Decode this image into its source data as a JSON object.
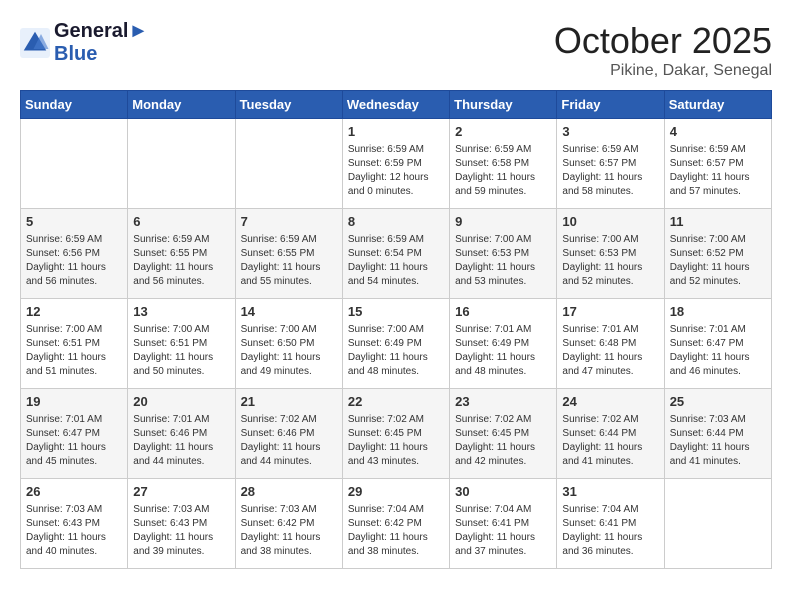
{
  "header": {
    "logo_line1": "General",
    "logo_line2": "Blue",
    "month": "October 2025",
    "location": "Pikine, Dakar, Senegal"
  },
  "days_of_week": [
    "Sunday",
    "Monday",
    "Tuesday",
    "Wednesday",
    "Thursday",
    "Friday",
    "Saturday"
  ],
  "weeks": [
    [
      {
        "day": "",
        "info": ""
      },
      {
        "day": "",
        "info": ""
      },
      {
        "day": "",
        "info": ""
      },
      {
        "day": "1",
        "info": "Sunrise: 6:59 AM\nSunset: 6:59 PM\nDaylight: 12 hours\nand 0 minutes."
      },
      {
        "day": "2",
        "info": "Sunrise: 6:59 AM\nSunset: 6:58 PM\nDaylight: 11 hours\nand 59 minutes."
      },
      {
        "day": "3",
        "info": "Sunrise: 6:59 AM\nSunset: 6:57 PM\nDaylight: 11 hours\nand 58 minutes."
      },
      {
        "day": "4",
        "info": "Sunrise: 6:59 AM\nSunset: 6:57 PM\nDaylight: 11 hours\nand 57 minutes."
      }
    ],
    [
      {
        "day": "5",
        "info": "Sunrise: 6:59 AM\nSunset: 6:56 PM\nDaylight: 11 hours\nand 56 minutes."
      },
      {
        "day": "6",
        "info": "Sunrise: 6:59 AM\nSunset: 6:55 PM\nDaylight: 11 hours\nand 56 minutes."
      },
      {
        "day": "7",
        "info": "Sunrise: 6:59 AM\nSunset: 6:55 PM\nDaylight: 11 hours\nand 55 minutes."
      },
      {
        "day": "8",
        "info": "Sunrise: 6:59 AM\nSunset: 6:54 PM\nDaylight: 11 hours\nand 54 minutes."
      },
      {
        "day": "9",
        "info": "Sunrise: 7:00 AM\nSunset: 6:53 PM\nDaylight: 11 hours\nand 53 minutes."
      },
      {
        "day": "10",
        "info": "Sunrise: 7:00 AM\nSunset: 6:53 PM\nDaylight: 11 hours\nand 52 minutes."
      },
      {
        "day": "11",
        "info": "Sunrise: 7:00 AM\nSunset: 6:52 PM\nDaylight: 11 hours\nand 52 minutes."
      }
    ],
    [
      {
        "day": "12",
        "info": "Sunrise: 7:00 AM\nSunset: 6:51 PM\nDaylight: 11 hours\nand 51 minutes."
      },
      {
        "day": "13",
        "info": "Sunrise: 7:00 AM\nSunset: 6:51 PM\nDaylight: 11 hours\nand 50 minutes."
      },
      {
        "day": "14",
        "info": "Sunrise: 7:00 AM\nSunset: 6:50 PM\nDaylight: 11 hours\nand 49 minutes."
      },
      {
        "day": "15",
        "info": "Sunrise: 7:00 AM\nSunset: 6:49 PM\nDaylight: 11 hours\nand 48 minutes."
      },
      {
        "day": "16",
        "info": "Sunrise: 7:01 AM\nSunset: 6:49 PM\nDaylight: 11 hours\nand 48 minutes."
      },
      {
        "day": "17",
        "info": "Sunrise: 7:01 AM\nSunset: 6:48 PM\nDaylight: 11 hours\nand 47 minutes."
      },
      {
        "day": "18",
        "info": "Sunrise: 7:01 AM\nSunset: 6:47 PM\nDaylight: 11 hours\nand 46 minutes."
      }
    ],
    [
      {
        "day": "19",
        "info": "Sunrise: 7:01 AM\nSunset: 6:47 PM\nDaylight: 11 hours\nand 45 minutes."
      },
      {
        "day": "20",
        "info": "Sunrise: 7:01 AM\nSunset: 6:46 PM\nDaylight: 11 hours\nand 44 minutes."
      },
      {
        "day": "21",
        "info": "Sunrise: 7:02 AM\nSunset: 6:46 PM\nDaylight: 11 hours\nand 44 minutes."
      },
      {
        "day": "22",
        "info": "Sunrise: 7:02 AM\nSunset: 6:45 PM\nDaylight: 11 hours\nand 43 minutes."
      },
      {
        "day": "23",
        "info": "Sunrise: 7:02 AM\nSunset: 6:45 PM\nDaylight: 11 hours\nand 42 minutes."
      },
      {
        "day": "24",
        "info": "Sunrise: 7:02 AM\nSunset: 6:44 PM\nDaylight: 11 hours\nand 41 minutes."
      },
      {
        "day": "25",
        "info": "Sunrise: 7:03 AM\nSunset: 6:44 PM\nDaylight: 11 hours\nand 41 minutes."
      }
    ],
    [
      {
        "day": "26",
        "info": "Sunrise: 7:03 AM\nSunset: 6:43 PM\nDaylight: 11 hours\nand 40 minutes."
      },
      {
        "day": "27",
        "info": "Sunrise: 7:03 AM\nSunset: 6:43 PM\nDaylight: 11 hours\nand 39 minutes."
      },
      {
        "day": "28",
        "info": "Sunrise: 7:03 AM\nSunset: 6:42 PM\nDaylight: 11 hours\nand 38 minutes."
      },
      {
        "day": "29",
        "info": "Sunrise: 7:04 AM\nSunset: 6:42 PM\nDaylight: 11 hours\nand 38 minutes."
      },
      {
        "day": "30",
        "info": "Sunrise: 7:04 AM\nSunset: 6:41 PM\nDaylight: 11 hours\nand 37 minutes."
      },
      {
        "day": "31",
        "info": "Sunrise: 7:04 AM\nSunset: 6:41 PM\nDaylight: 11 hours\nand 36 minutes."
      },
      {
        "day": "",
        "info": ""
      }
    ]
  ]
}
